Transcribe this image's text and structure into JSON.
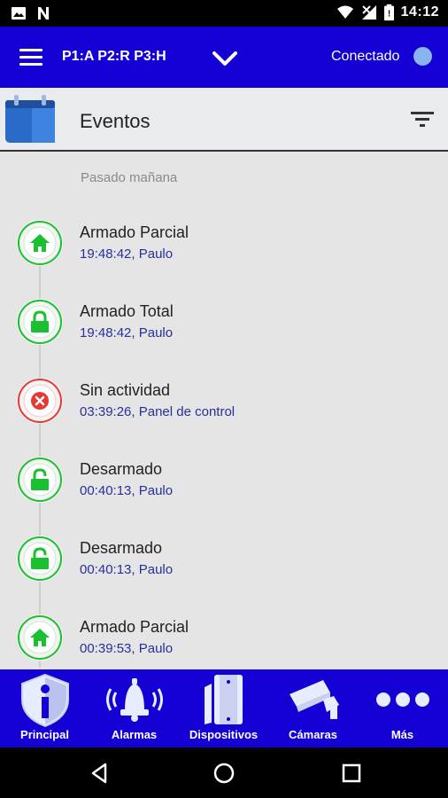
{
  "status_bar": {
    "time": "14:12",
    "icons": [
      "image-icon",
      "n-icon",
      "wifi-icon",
      "no-signal-icon",
      "battery-icon"
    ]
  },
  "app_bar": {
    "partitions": "P1:A P2:R P3:H",
    "connection_label": "Conectado",
    "connection_color": "#8ab4f0"
  },
  "header": {
    "title": "Eventos"
  },
  "events": {
    "section": "Pasado mañana",
    "items": [
      {
        "title": "Armado Parcial",
        "sub": "19:48:42, Paulo",
        "icon": "home-icon",
        "color": "#19c02f"
      },
      {
        "title": "Armado Total",
        "sub": "19:48:42, Paulo",
        "icon": "lock-closed-icon",
        "color": "#19c02f"
      },
      {
        "title": "Sin actividad",
        "sub": "03:39:26, Panel de control",
        "icon": "x-circle-icon",
        "color": "#e53935"
      },
      {
        "title": "Desarmado",
        "sub": "00:40:13, Paulo",
        "icon": "lock-open-icon",
        "color": "#19c02f"
      },
      {
        "title": "Desarmado",
        "sub": "00:40:13, Paulo",
        "icon": "lock-open-icon",
        "color": "#19c02f"
      },
      {
        "title": "Armado Parcial",
        "sub": "00:39:53, Paulo",
        "icon": "home-icon",
        "color": "#19c02f"
      }
    ]
  },
  "bottom_nav": {
    "items": [
      {
        "label": "Principal",
        "icon": "shield-info-icon"
      },
      {
        "label": "Alarmas",
        "icon": "bell-icon"
      },
      {
        "label": "Dispositivos",
        "icon": "door-sensor-icon"
      },
      {
        "label": "Cámaras",
        "icon": "camera-icon"
      },
      {
        "label": "Más",
        "icon": "more-icon"
      }
    ]
  },
  "colors": {
    "brand_blue": "#1400d4",
    "ok_green": "#19c02f",
    "alert_red": "#e53935",
    "sub_text": "#26309a"
  }
}
